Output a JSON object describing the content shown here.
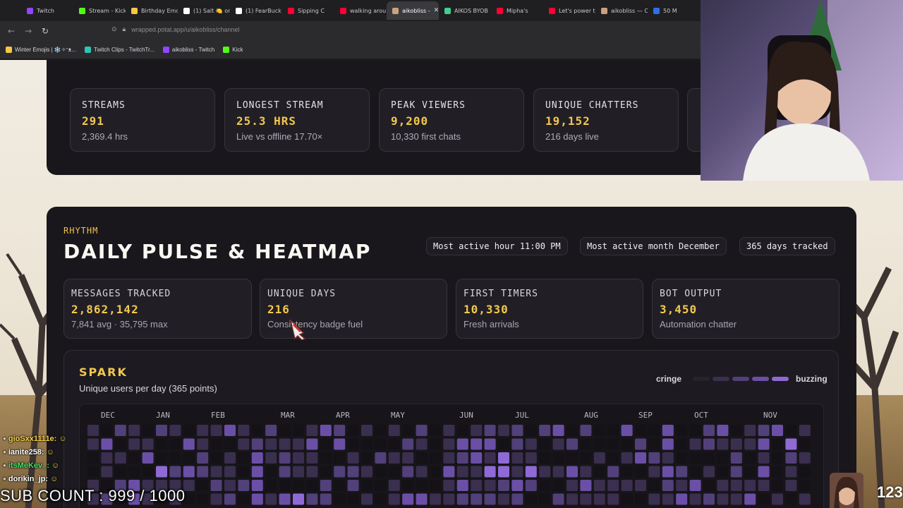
{
  "browser": {
    "tabs": [
      {
        "label": "Twitch",
        "color": "#9146ff"
      },
      {
        "label": "Stream - Kick",
        "color": "#53fc18"
      },
      {
        "label": "Birthday Emo",
        "color": "#f6c744"
      },
      {
        "label": "(1) Salt 🍋 or",
        "color": "#ffffff"
      },
      {
        "label": "(1) FearBuck",
        "color": "#ffffff"
      },
      {
        "label": "Sipping C",
        "color": "#ff0033"
      },
      {
        "label": "walking arou",
        "color": "#ff0033"
      },
      {
        "label": "aikobliss -",
        "color": "#c9a27c",
        "active": true
      },
      {
        "label": "AIKOS BYOB",
        "color": "#3ecf8e"
      },
      {
        "label": "Mipha's",
        "color": "#ff0033"
      },
      {
        "label": "Let's power th",
        "color": "#ff0033"
      },
      {
        "label": "aikobliss — C",
        "color": "#c9a27c"
      },
      {
        "label": "50 M",
        "color": "#2f6fe4"
      }
    ],
    "url": "wrapped.potat.app/u/aikobliss/channel",
    "bookmarks": [
      {
        "label": "Winter Emojis | ❄️✧ᵔᴥ...",
        "color": "#f6c744"
      },
      {
        "label": "Twitch Clips - TwitchTr...",
        "color": "#2ec4b6"
      },
      {
        "label": "aikobliss - Twitch",
        "color": "#9146ff"
      },
      {
        "label": "Kick",
        "color": "#53fc18"
      }
    ]
  },
  "top_stats": [
    {
      "label": "STREAMS",
      "value": "291",
      "sub": "2,369.4 hrs"
    },
    {
      "label": "LONGEST STREAM",
      "value": "25.3 HRS",
      "sub": "Live vs offline 17.70×"
    },
    {
      "label": "PEAK VIEWERS",
      "value": "9,200",
      "sub": "10,330 first chats"
    },
    {
      "label": "UNIQUE CHATTERS",
      "value": "19,152",
      "sub": "216 days live"
    }
  ],
  "rhythm": {
    "eyebrow": "RHYTHM",
    "title": "DAILY PULSE & HEATMAP",
    "pills": [
      "Most active hour 11:00 PM",
      "Most active month December",
      "365 days tracked"
    ],
    "stats": [
      {
        "label": "MESSAGES TRACKED",
        "value": "2,862,142",
        "sub": "7,841 avg · 35,795 max"
      },
      {
        "label": "UNIQUE DAYS",
        "value": "216",
        "sub": "Consistency badge fuel"
      },
      {
        "label": "FIRST TIMERS",
        "value": "10,330",
        "sub": "Fresh arrivals"
      },
      {
        "label": "BOT OUTPUT",
        "value": "3,450",
        "sub": "Automation chatter"
      }
    ]
  },
  "spark": {
    "title": "SPARK",
    "subtitle": "Unique users per day (365 points)",
    "legend_low": "cringe",
    "legend_high": "buzzing",
    "legend_colors": [
      "#26232b",
      "#3a2f4e",
      "#52407a",
      "#6b4fa6",
      "#8f6ad6"
    ],
    "months": [
      "DEC",
      "JAN",
      "FEB",
      "MAR",
      "APR",
      "MAY",
      "JUN",
      "JUL",
      "AUG",
      "SEP",
      "OCT",
      "NOV"
    ]
  },
  "overlay": {
    "chat": [
      {
        "name": "gioSxx1111e:",
        "color": "#f5d04b"
      },
      {
        "name": "ianite258:",
        "color": "#ffffff"
      },
      {
        "name": "itsMeKev_:",
        "color": "#49e06a"
      },
      {
        "name": "dorikin_jp:",
        "color": "#ffffff"
      }
    ],
    "sub_count": "SUB COUNT : 999 / 1000",
    "counter": "123"
  }
}
